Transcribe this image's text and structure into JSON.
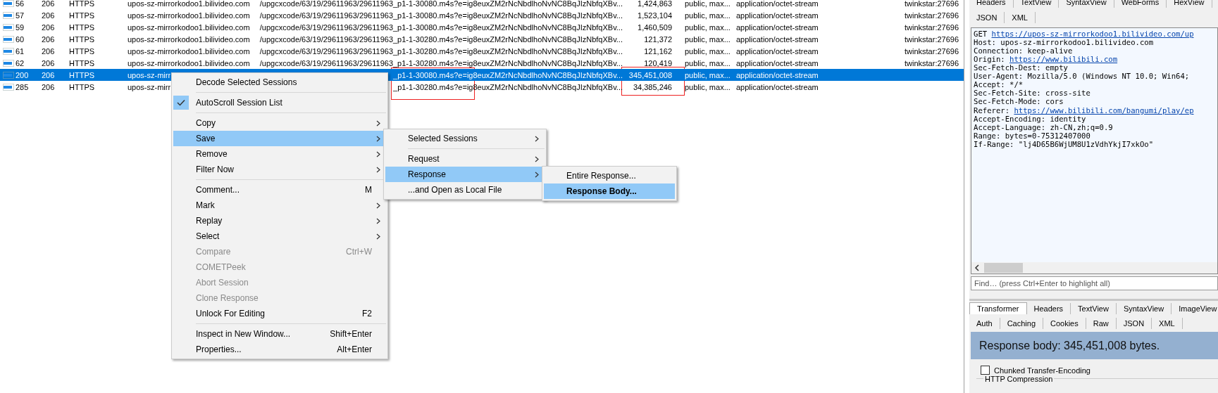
{
  "sessions": [
    {
      "selected": false,
      "cells": [
        "56",
        "206",
        "HTTPS",
        "upos-sz-mirrorkodoo1.bilivideo.com",
        "/upgcxcode/63/19/29611963/29611963_p1-1-30080.m4s?e=ig8euxZM2rNcNbdlhoNvNC8BqJIzNbfqXBv...",
        "1,424,863",
        "public, max...",
        "application/octet-stream",
        "twinkstar:27696"
      ]
    },
    {
      "selected": false,
      "cells": [
        "57",
        "206",
        "HTTPS",
        "upos-sz-mirrorkodoo1.bilivideo.com",
        "/upgcxcode/63/19/29611963/29611963_p1-1-30080.m4s?e=ig8euxZM2rNcNbdlhoNvNC8BqJIzNbfqXBv...",
        "1,523,104",
        "public, max...",
        "application/octet-stream",
        "twinkstar:27696"
      ]
    },
    {
      "selected": false,
      "cells": [
        "59",
        "206",
        "HTTPS",
        "upos-sz-mirrorkodoo1.bilivideo.com",
        "/upgcxcode/63/19/29611963/29611963_p1-1-30080.m4s?e=ig8euxZM2rNcNbdlhoNvNC8BqJIzNbfqXBv...",
        "1,460,509",
        "public, max...",
        "application/octet-stream",
        "twinkstar:27696"
      ]
    },
    {
      "selected": false,
      "cells": [
        "60",
        "206",
        "HTTPS",
        "upos-sz-mirrorkodoo1.bilivideo.com",
        "/upgcxcode/63/19/29611963/29611963_p1-1-30280.m4s?e=ig8euxZM2rNcNbdlhoNvNC8BqJIzNbfqXBv...",
        "121,372",
        "public, max...",
        "application/octet-stream",
        "twinkstar:27696"
      ]
    },
    {
      "selected": false,
      "cells": [
        "61",
        "206",
        "HTTPS",
        "upos-sz-mirrorkodoo1.bilivideo.com",
        "/upgcxcode/63/19/29611963/29611963_p1-1-30280.m4s?e=ig8euxZM2rNcNbdlhoNvNC8BqJIzNbfqXBv...",
        "121,162",
        "public, max...",
        "application/octet-stream",
        "twinkstar:27696"
      ]
    },
    {
      "selected": false,
      "cells": [
        "62",
        "206",
        "HTTPS",
        "upos-sz-mirrorkodoo1.bilivideo.com",
        "/upgcxcode/63/19/29611963/29611963_p1-1-30280.m4s?e=ig8euxZM2rNcNbdlhoNvNC8BqJIzNbfqXBv...",
        "120,419",
        "public, max...",
        "application/octet-stream",
        "twinkstar:27696"
      ]
    },
    {
      "selected": true,
      "cells": [
        "200",
        "206",
        "HTTPS",
        "upos-sz-mirr",
        "_p1-1-30080.m4s?e=ig8euxZM2rNcNbdlhoNvNC8BqJIzNbfqXBv...",
        "345,451,008",
        "public, max...",
        "application/octet-stream"
      ]
    },
    {
      "selected": false,
      "cells": [
        "285",
        "206",
        "HTTPS",
        "upos-sz-mirr",
        "_p1-1-30280.m4s?e=ig8euxZM2rNcNbdlhoNvNC8BqJIzNbfqXBv...",
        "34,385,246",
        "public, max...",
        "application/octet-stream"
      ]
    }
  ],
  "menus": [
    {
      "groups": [
        [
          {
            "label": "Decode Selected Sessions",
            "submenu": false,
            "checked": false,
            "disabled": false,
            "selected": false
          }
        ],
        [
          {
            "label": "AutoScroll Session List",
            "submenu": false,
            "checked": true,
            "disabled": false,
            "selected": false
          }
        ],
        [
          {
            "label": "Copy",
            "submenu": true,
            "checked": false,
            "disabled": false,
            "selected": false
          },
          {
            "label": "Save",
            "submenu": true,
            "checked": false,
            "disabled": false,
            "selected": true
          },
          {
            "label": "Remove",
            "submenu": true,
            "checked": false,
            "disabled": false,
            "selected": false
          },
          {
            "label": "Filter Now",
            "submenu": true,
            "checked": false,
            "disabled": false,
            "selected": false
          }
        ],
        [
          {
            "label": "Comment...",
            "shortcut": "M",
            "submenu": false,
            "checked": false,
            "disabled": false,
            "selected": false
          },
          {
            "label": "Mark",
            "submenu": true,
            "checked": false,
            "disabled": false,
            "selected": false
          },
          {
            "label": "Replay",
            "submenu": true,
            "checked": false,
            "disabled": false,
            "selected": false
          },
          {
            "label": "Select",
            "submenu": true,
            "checked": false,
            "disabled": false,
            "selected": false
          },
          {
            "label": "Compare",
            "shortcut": "Ctrl+W",
            "submenu": false,
            "checked": false,
            "disabled": true,
            "selected": false
          },
          {
            "label": "COMETPeek",
            "submenu": false,
            "checked": false,
            "disabled": true,
            "selected": false
          },
          {
            "label": "Abort Session",
            "submenu": false,
            "checked": false,
            "disabled": true,
            "selected": false
          },
          {
            "label": "Clone Response",
            "submenu": false,
            "checked": false,
            "disabled": true,
            "selected": false
          },
          {
            "label": "Unlock For Editing",
            "shortcut": "F2",
            "submenu": false,
            "checked": false,
            "disabled": false,
            "selected": false
          }
        ],
        [
          {
            "label": "Inspect in New Window...",
            "shortcut": "Shift+Enter",
            "submenu": false,
            "checked": false,
            "disabled": false,
            "selected": false
          },
          {
            "label": "Properties...",
            "shortcut": "Alt+Enter",
            "submenu": false,
            "checked": false,
            "disabled": false,
            "selected": false
          }
        ]
      ]
    },
    {
      "groups": [
        [
          {
            "label": "Selected Sessions",
            "submenu": true,
            "checked": false,
            "disabled": false,
            "selected": false
          }
        ],
        [
          {
            "label": "Request",
            "submenu": true,
            "checked": false,
            "disabled": false,
            "selected": false
          },
          {
            "label": "Response",
            "submenu": true,
            "checked": false,
            "disabled": false,
            "selected": true
          },
          {
            "label": "...and Open as Local File",
            "submenu": false,
            "checked": false,
            "disabled": false,
            "selected": false
          }
        ]
      ]
    },
    {
      "groups": [
        [
          {
            "label": "Entire Response...",
            "submenu": false,
            "checked": false,
            "disabled": false,
            "selected": false,
            "default": false
          },
          {
            "label": "Response Body...",
            "submenu": false,
            "checked": false,
            "disabled": false,
            "selected": true,
            "default": true
          }
        ]
      ]
    }
  ],
  "request": {
    "tabs": [
      {
        "label": "Headers",
        "selected": false
      },
      {
        "label": "TextView",
        "selected": false
      },
      {
        "label": "SyntaxView",
        "selected": false
      },
      {
        "label": "WebForms",
        "selected": false
      },
      {
        "label": "HexView",
        "selected": false
      }
    ],
    "subtabs": [
      {
        "label": "JSON",
        "selected": false
      },
      {
        "label": "XML",
        "selected": false
      }
    ],
    "lines": [
      {
        "text": "GET ",
        "link": "https://upos-sz-mirrorkodoo1.bilivideo.com/up"
      },
      {
        "text": "Host: upos-sz-mirrorkodoo1.bilivideo.com"
      },
      {
        "text": "Connection: keep-alive"
      },
      {
        "text": "Origin: ",
        "link": "https://www.bilibili.com"
      },
      {
        "text": "Sec-Fetch-Dest: empty"
      },
      {
        "text": "User-Agent: Mozilla/5.0 (Windows NT 10.0; Win64;"
      },
      {
        "text": "Accept: */*"
      },
      {
        "text": "Sec-Fetch-Site: cross-site"
      },
      {
        "text": "Sec-Fetch-Mode: cors"
      },
      {
        "text": "Referer: ",
        "link": "https://www.bilibili.com/bangumi/play/ep"
      },
      {
        "text": "Accept-Encoding: identity"
      },
      {
        "text": "Accept-Language: zh-CN,zh;q=0.9"
      },
      {
        "text": "Range: bytes=0-75312407000"
      },
      {
        "text": "If-Range: \"lj4D65B6WjUM8U1zVdhYkjI7xkOo\""
      }
    ],
    "find": {
      "placeholder": "Find… (press Ctrl+Enter to highlight all)"
    }
  },
  "response": {
    "tabs": [
      {
        "label": "Transformer",
        "selected": true
      },
      {
        "label": "Headers",
        "selected": false
      },
      {
        "label": "TextView",
        "selected": false
      },
      {
        "label": "SyntaxView",
        "selected": false
      },
      {
        "label": "ImageView",
        "selected": false
      }
    ],
    "subtabs": [
      {
        "label": "Auth",
        "selected": false
      },
      {
        "label": "Caching",
        "selected": false
      },
      {
        "label": "Cookies",
        "selected": false
      },
      {
        "label": "Raw",
        "selected": false
      },
      {
        "label": "JSON",
        "selected": false
      },
      {
        "label": "XML",
        "selected": false
      }
    ],
    "banner": "Response body: 345,451,008 bytes.",
    "chunked": {
      "label": "Chunked Transfer-Encoding",
      "checked": false
    },
    "group_label": "HTTP Compression"
  }
}
